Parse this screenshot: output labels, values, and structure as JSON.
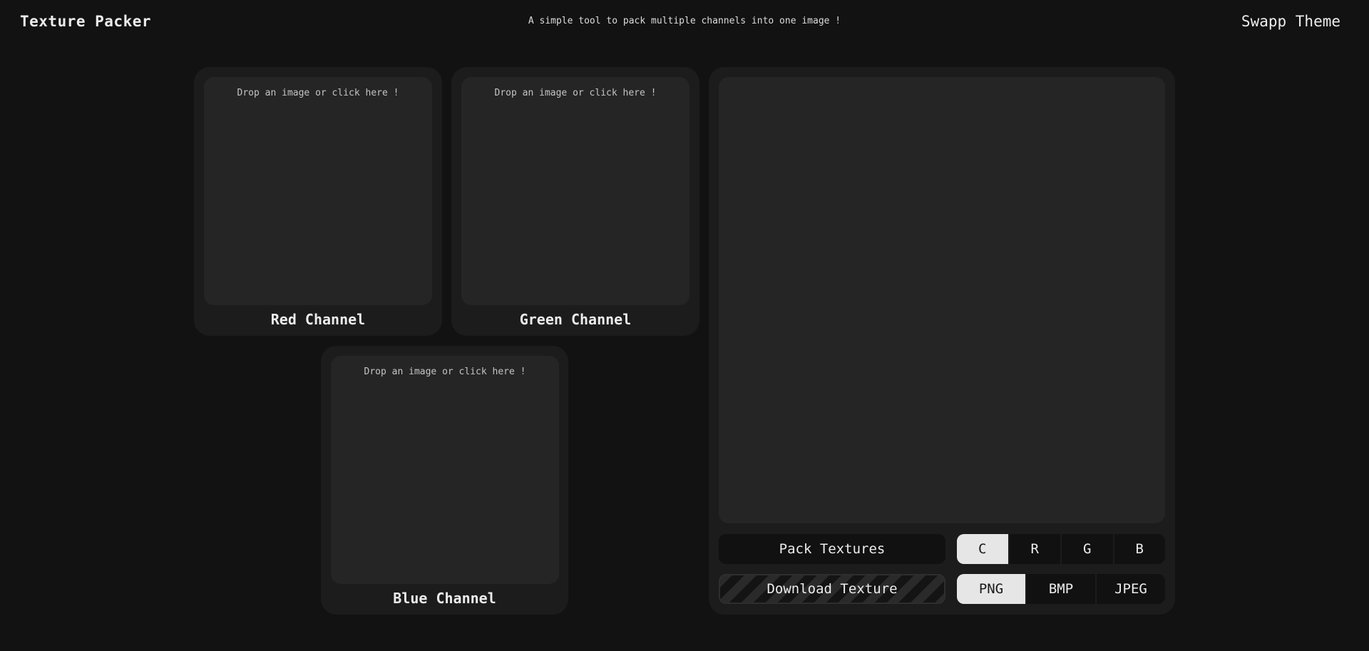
{
  "header": {
    "title": "Texture Packer",
    "tagline": "A simple tool to pack multiple channels into one image !",
    "theme_button": "Swapp Theme"
  },
  "channels": {
    "red": {
      "drop_text": "Drop an image or click here !",
      "label": "Red Channel"
    },
    "green": {
      "drop_text": "Drop an image or click here !",
      "label": "Green Channel"
    },
    "blue": {
      "drop_text": "Drop an image or click here !",
      "label": "Blue Channel"
    }
  },
  "output": {
    "pack_button": "Pack Textures",
    "download_button": "Download Texture",
    "channel_modes": [
      "C",
      "R",
      "G",
      "B"
    ],
    "selected_channel_mode": "C",
    "formats": [
      "PNG",
      "BMP",
      "JPEG"
    ],
    "selected_format": "PNG"
  },
  "colors": {
    "background": "#121212",
    "card": "#1c1c1c",
    "dropzone": "#252525",
    "active_toggle": "#e6e6e6"
  }
}
